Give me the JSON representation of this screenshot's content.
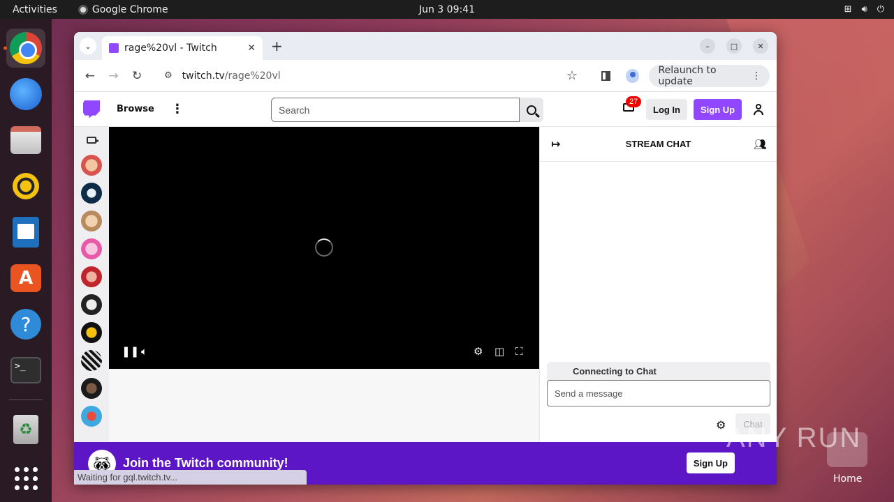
{
  "topbar": {
    "activities": "Activities",
    "app_name": "Google Chrome",
    "clock": "Jun 3  09:41",
    "tray_icons": [
      "network-icon",
      "volume-icon",
      "power-icon"
    ]
  },
  "dock": {
    "items": [
      "chrome",
      "thunderbird",
      "files",
      "rhythmbox",
      "writer",
      "app-store",
      "help",
      "terminal",
      "trash",
      "show-apps"
    ]
  },
  "browser": {
    "tab_title": "rage%20vl - Twitch",
    "url_host": "twitch.tv",
    "url_path": "/rage%20vl",
    "relaunch_label": "Relaunch to update",
    "status_text": "Waiting for gql.twitch.tv..."
  },
  "twitch": {
    "browse": "Browse",
    "search_placeholder": "Search",
    "inbox_count": "27",
    "login": "Log In",
    "signup": "Sign Up",
    "chat_title": "STREAM CHAT",
    "connecting": "Connecting to Chat",
    "message_placeholder": "Send a message",
    "chat_button": "Chat",
    "banner_text": "Join the Twitch community!",
    "banner_signup": "Sign Up",
    "accent": "#9146ff"
  },
  "desktop": {
    "watermark": "ANY RUN",
    "home_label": "Home"
  }
}
